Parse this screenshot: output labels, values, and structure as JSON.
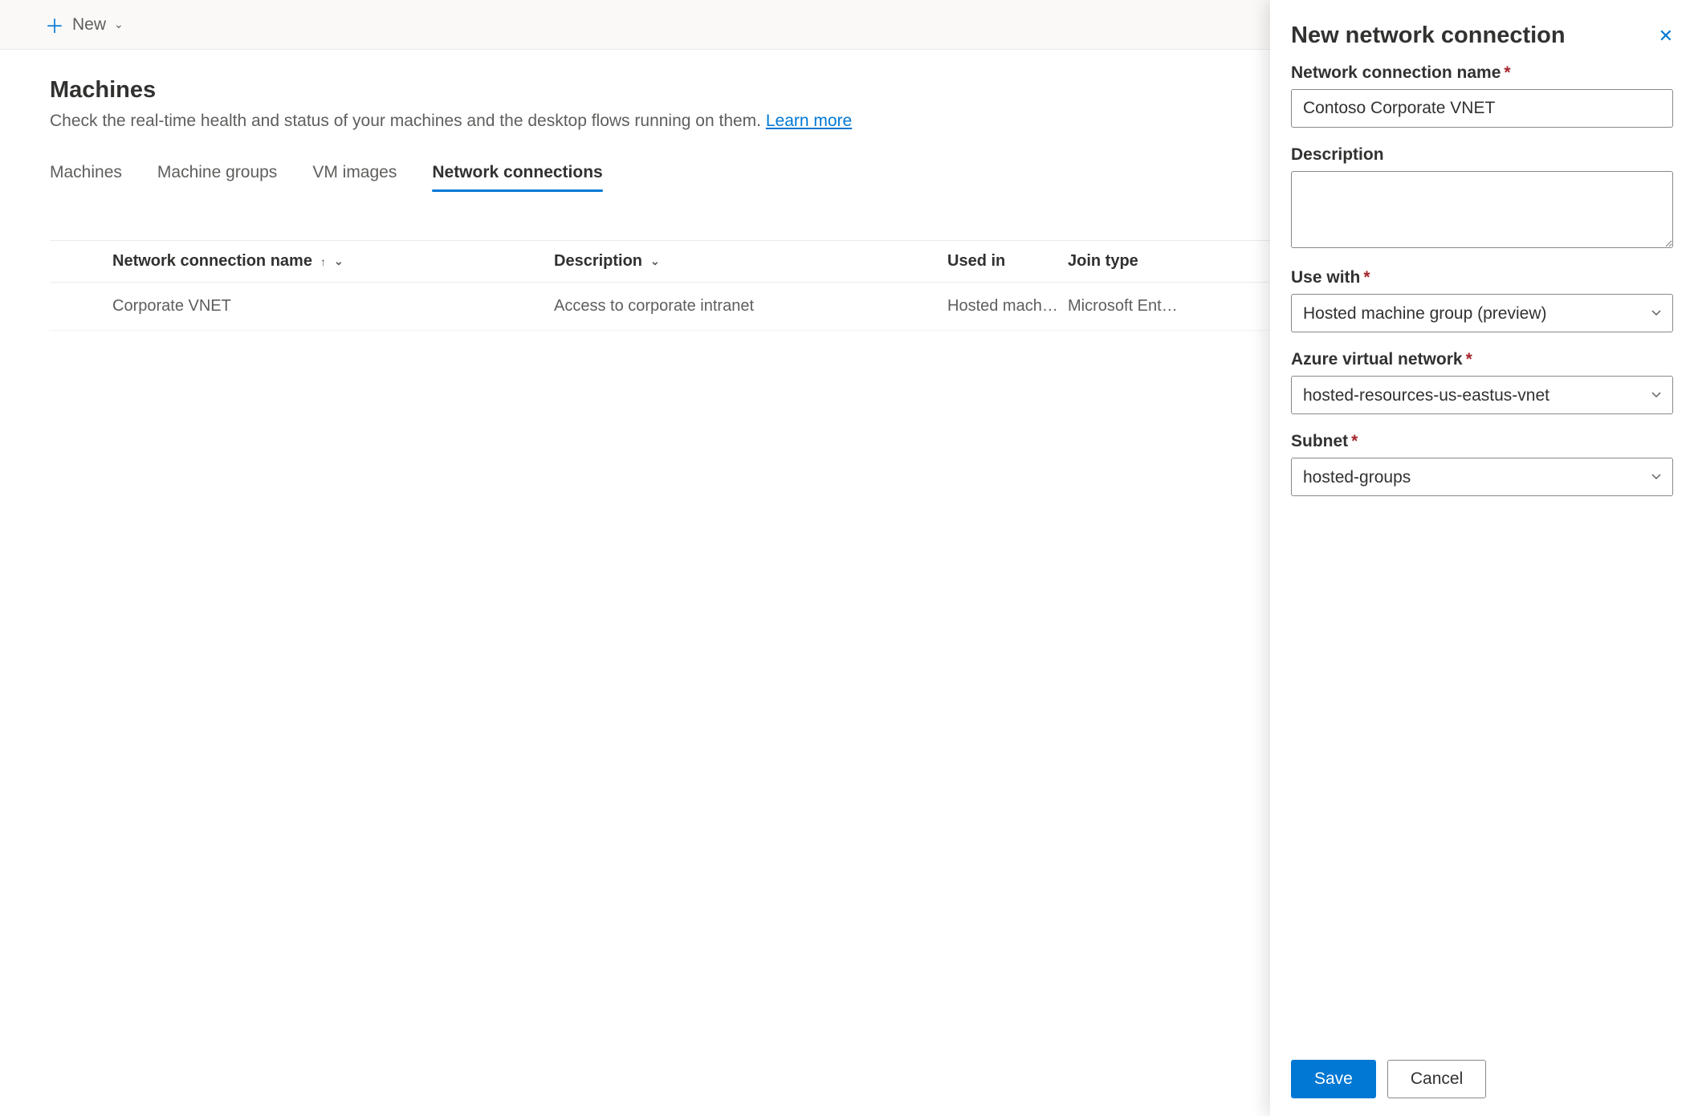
{
  "commandBar": {
    "newLabel": "New"
  },
  "page": {
    "title": "Machines",
    "subtitle": "Check the real-time health and status of your machines and the desktop flows running on them. ",
    "learnMore": "Learn more"
  },
  "tabs": {
    "machines": "Machines",
    "machineGroups": "Machine groups",
    "vmImages": "VM images",
    "networkConnections": "Network connections"
  },
  "table": {
    "headers": {
      "name": "Network connection name",
      "description": "Description",
      "usedIn": "Used in",
      "joinType": "Join type"
    },
    "rows": [
      {
        "name": "Corporate VNET",
        "description": "Access to corporate intranet",
        "usedIn": "Hosted mach…",
        "joinType": "Microsoft Ent…"
      }
    ]
  },
  "panel": {
    "title": "New network connection",
    "fields": {
      "nameLabel": "Network connection name",
      "nameValue": "Contoso Corporate VNET",
      "descriptionLabel": "Description",
      "descriptionValue": "",
      "useWithLabel": "Use with",
      "useWithValue": "Hosted machine group (preview)",
      "avnLabel": "Azure virtual network",
      "avnValue": "hosted-resources-us-eastus-vnet",
      "subnetLabel": "Subnet",
      "subnetValue": "hosted-groups"
    },
    "buttons": {
      "save": "Save",
      "cancel": "Cancel"
    }
  }
}
